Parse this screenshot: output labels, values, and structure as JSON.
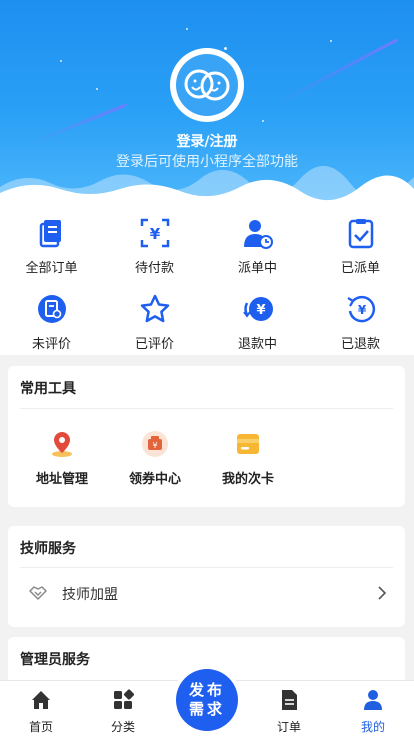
{
  "header": {
    "login_title": "登录/注册",
    "login_subtitle": "登录后可使用小程序全部功能"
  },
  "orders": [
    {
      "label": "全部订单",
      "icon": "all-orders-icon"
    },
    {
      "label": "待付款",
      "icon": "pending-payment-icon"
    },
    {
      "label": "派单中",
      "icon": "dispatching-icon"
    },
    {
      "label": "已派单",
      "icon": "dispatched-icon"
    },
    {
      "label": "未评价",
      "icon": "unrated-icon"
    },
    {
      "label": "已评价",
      "icon": "rated-icon"
    },
    {
      "label": "退款中",
      "icon": "refunding-icon"
    },
    {
      "label": "已退款",
      "icon": "refunded-icon"
    }
  ],
  "tools": {
    "title": "常用工具",
    "items": [
      {
        "label": "地址管理",
        "icon": "location-pin-icon"
      },
      {
        "label": "领券中心",
        "icon": "coupon-icon"
      },
      {
        "label": "我的次卡",
        "icon": "card-icon"
      }
    ]
  },
  "technician": {
    "title": "技师服务",
    "items": [
      {
        "label": "技师加盟",
        "icon": "handshake-icon"
      }
    ]
  },
  "admin": {
    "title": "管理员服务"
  },
  "nav": {
    "items": [
      {
        "label": "首页",
        "icon": "home-icon"
      },
      {
        "label": "分类",
        "icon": "category-icon"
      },
      {
        "label": "订单",
        "icon": "document-icon"
      },
      {
        "label": "我的",
        "icon": "user-icon",
        "active": true
      }
    ],
    "publish_line1": "发布",
    "publish_line2": "需求"
  },
  "colors": {
    "primary": "#1e5ff0",
    "header": "#2aa0f6"
  }
}
